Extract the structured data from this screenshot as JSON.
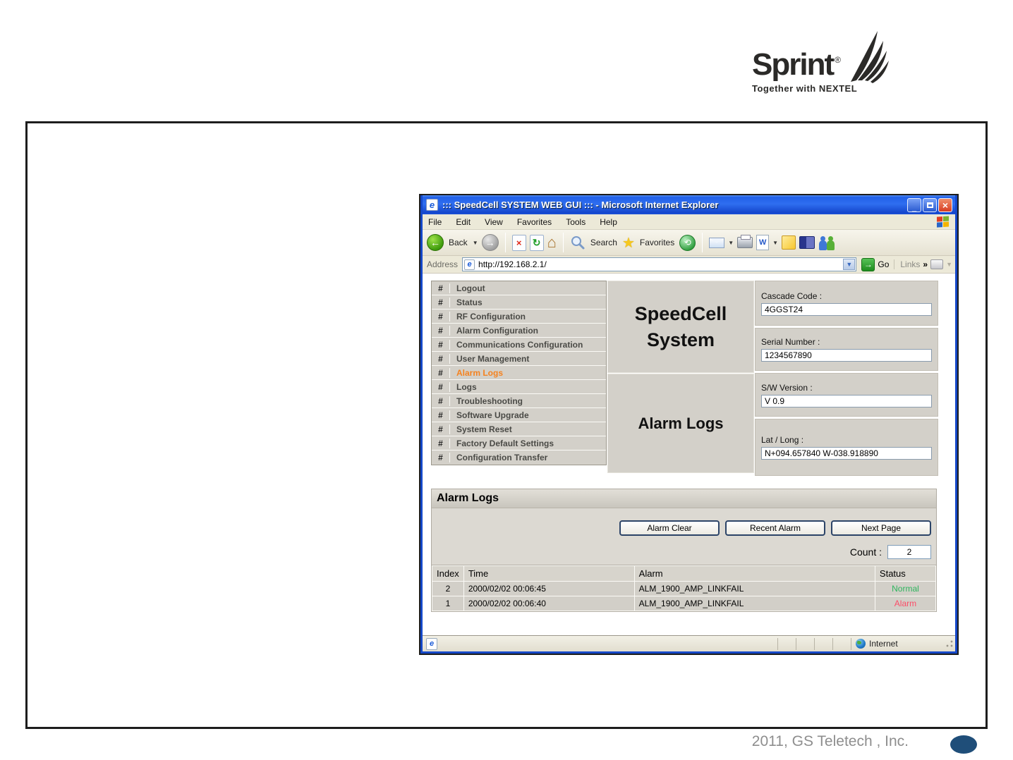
{
  "slide": {
    "footer": "2011, GS Teletech , Inc.",
    "logo": {
      "brand": "Sprint",
      "reg": "®",
      "tagline": "Together with NEXTEL"
    }
  },
  "colors": {
    "nav_active": "#f5821f",
    "status_normal": "#2eb55e",
    "status_alarm": "#fb4d68"
  },
  "window": {
    "title": "::: SpeedCell SYSTEM WEB GUI ::: - Microsoft Internet Explorer",
    "menu": [
      "File",
      "Edit",
      "View",
      "Favorites",
      "Tools",
      "Help"
    ],
    "toolbar": {
      "back": "Back",
      "search": "Search",
      "favorites": "Favorites"
    },
    "address": {
      "label": "Address",
      "url": "http://192.168.2.1/",
      "go": "Go",
      "links": "Links",
      "chevron": "»"
    },
    "statusbar": {
      "zone": "Internet"
    }
  },
  "page": {
    "nav": {
      "bullet": "#",
      "items": [
        {
          "label": "Logout"
        },
        {
          "label": "Status"
        },
        {
          "label": "RF Configuration"
        },
        {
          "label": "Alarm Configuration"
        },
        {
          "label": "Communications Configuration"
        },
        {
          "label": "User Management"
        },
        {
          "label": "Alarm Logs",
          "active": true
        },
        {
          "label": "Logs"
        },
        {
          "label": "Troubleshooting"
        },
        {
          "label": "Software Upgrade"
        },
        {
          "label": "System Reset"
        },
        {
          "label": "Factory Default Settings"
        },
        {
          "label": "Configuration Transfer"
        }
      ]
    },
    "header": {
      "system": "SpeedCell System",
      "context": "Alarm Logs"
    },
    "device": [
      {
        "label": "Cascade Code :",
        "value": "4GGST24"
      },
      {
        "label": "Serial Number :",
        "value": "1234567890"
      },
      {
        "label": "S/W Version :",
        "value": "V 0.9"
      },
      {
        "label": "Lat / Long :",
        "value": "N+094.657840 W-038.918890"
      }
    ],
    "section": {
      "title": "Alarm Logs",
      "buttons": [
        "Alarm Clear",
        "Recent Alarm",
        "Next Page"
      ],
      "count_label": "Count :",
      "count_value": "2",
      "table": {
        "headers": [
          "Index",
          "Time",
          "Alarm",
          "Status"
        ],
        "rows": [
          {
            "index": "2",
            "time": "2000/02/02 00:06:45",
            "alarm": "ALM_1900_AMP_LINKFAIL",
            "status": "Normal"
          },
          {
            "index": "1",
            "time": "2000/02/02 00:06:40",
            "alarm": "ALM_1900_AMP_LINKFAIL",
            "status": "Alarm"
          }
        ]
      }
    }
  }
}
